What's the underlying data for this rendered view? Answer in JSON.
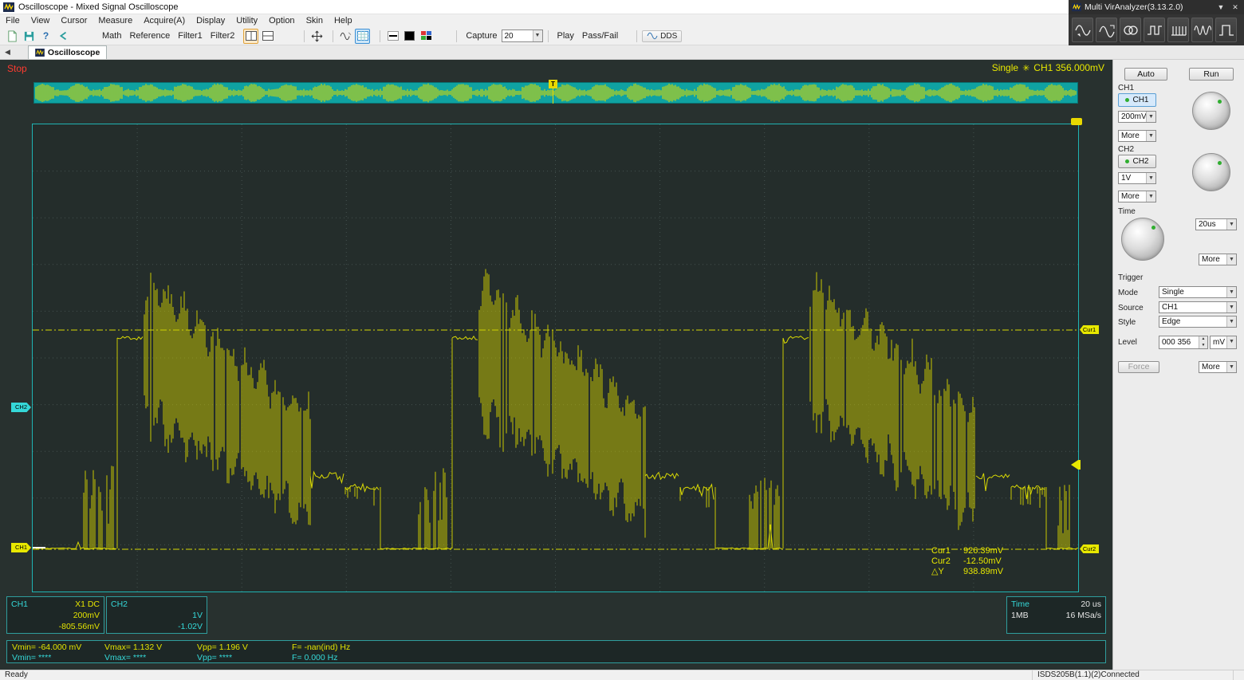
{
  "window": {
    "title": "Oscilloscope - Mixed Signal Oscilloscope"
  },
  "analyzer": {
    "title": "Multi VirAnalyzer(3.13.2.0)"
  },
  "menu": {
    "items": [
      "File",
      "View",
      "Cursor",
      "Measure",
      "Acquire(A)",
      "Display",
      "Utility",
      "Option",
      "Skin",
      "Help"
    ]
  },
  "toolbar": {
    "buttons": [
      "Math",
      "Reference",
      "Filter1",
      "Filter2"
    ],
    "capture_label": "Capture",
    "capture_value": "20",
    "play_label": "Play",
    "passfail_label": "Pass/Fail",
    "dds_label": "DDS"
  },
  "tabs": [
    {
      "label": "Oscilloscope"
    }
  ],
  "scope": {
    "status": "Stop",
    "trigger_mode": "Single",
    "trigger_value": "CH1 356.000mV",
    "markers": {
      "ch1": "CH1",
      "ch2": "CH2",
      "cur1": "Cur1",
      "cur2": "Cur2",
      "strip_t": "T"
    },
    "cursors": {
      "cur1_label": "Cur1",
      "cur1_value": "926.39mV",
      "cur2_label": "Cur2",
      "cur2_value": "-12.50mV",
      "dy_label": "△Y",
      "dy_value": "938.89mV"
    },
    "waveform": {
      "baseline": 532,
      "flat_level": 268,
      "dense_width": 208,
      "dense_starts": [
        140,
        560,
        975
      ]
    }
  },
  "info": {
    "ch1": {
      "name": "CH1",
      "coupling": "X1  DC",
      "scale": "200mV",
      "offset": "-805.56mV"
    },
    "ch2": {
      "name": "CH2",
      "scale": "1V",
      "offset": "-1.02V"
    },
    "time": {
      "label": "Time",
      "scale": "20 us",
      "depth": "1MB",
      "rate": "16 MSa/s"
    }
  },
  "measure": {
    "row1": [
      "Vmin= -64.000 mV",
      "Vmax= 1.132 V",
      "Vpp= 1.196 V",
      "F= -nan(ind) Hz"
    ],
    "row2": [
      "Vmin= ****",
      "Vmax= ****",
      "Vpp= ****",
      "F= 0.000 Hz"
    ]
  },
  "panel": {
    "auto": "Auto",
    "run": "Run",
    "ch1": {
      "label": "CH1",
      "button": "CH1",
      "scale": "200mV",
      "more": "More"
    },
    "ch2": {
      "label": "CH2",
      "button": "CH2",
      "scale": "1V",
      "more": "More"
    },
    "time": {
      "label": "Time",
      "scale": "20us",
      "more": "More"
    },
    "trigger": {
      "title": "Trigger",
      "mode_label": "Mode",
      "mode": "Single",
      "source_label": "Source",
      "source": "CH1",
      "style_label": "Style",
      "style": "Edge",
      "level_label": "Level",
      "level": "000 356",
      "unit": "mV",
      "force": "Force",
      "more": "More"
    }
  },
  "status": {
    "left": "Ready",
    "device": "ISDS205B(1.1)(2)Connected"
  },
  "colors": {
    "accent_teal": "#1fb3b3",
    "waveform_yellow": "#d9d904",
    "status_red": "#ff3b30",
    "readout_yellow": "#e8e800",
    "cyan_text": "#35d8d8"
  }
}
